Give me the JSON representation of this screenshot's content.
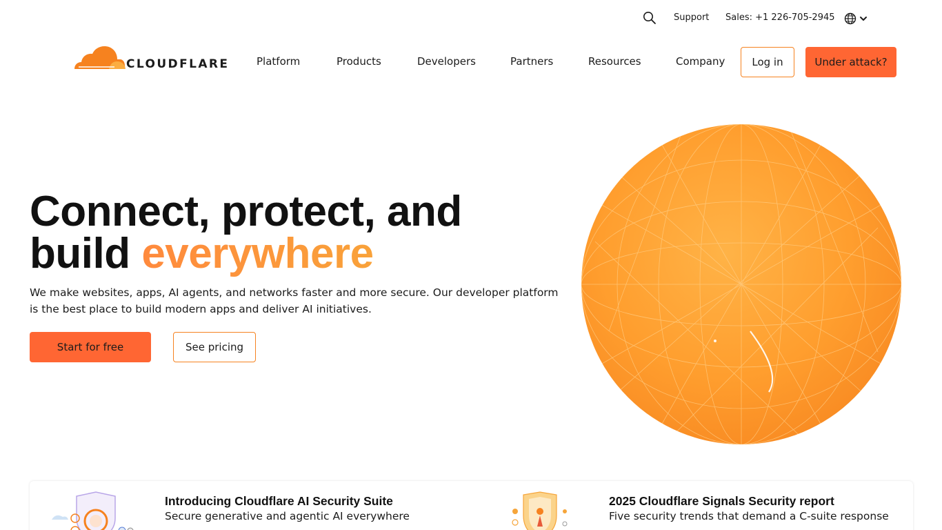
{
  "utility_bar": {
    "search_icon": "search-icon",
    "support_label": "Support",
    "sales_label": "Sales: +1 226-705-2945",
    "language_icon": "globe-icon"
  },
  "brand": {
    "logo_text": "CLOUDFLARE",
    "logo_colors": {
      "primary": "#f6821f",
      "secondary": "#fbad41"
    }
  },
  "nav": {
    "items": [
      {
        "label": "Platform"
      },
      {
        "label": "Products"
      },
      {
        "label": "Developers"
      },
      {
        "label": "Partners"
      },
      {
        "label": "Resources"
      },
      {
        "label": "Company"
      }
    ],
    "login_label": "Log in",
    "attack_label": "Under attack?"
  },
  "hero": {
    "title_part1": "Connect, protect, and",
    "title_part2": "build",
    "title_accent": "everywhere",
    "subtitle": "We make websites, apps, AI agents, and networks faster and more secure. Our developer platform is the best place to build modern apps and deliver AI initiatives.",
    "cta_primary": "Start for free",
    "cta_secondary": "See pricing"
  },
  "promos": [
    {
      "title": "Introducing Cloudflare AI Security Suite",
      "description": "Secure generative and agentic AI everywhere"
    },
    {
      "title": "2025 Cloudflare Signals Security report",
      "description": "Five security trends that demand a C-suite response"
    }
  ],
  "colors": {
    "accent": "#ff6633",
    "brand_orange": "#f6821f",
    "text": "#1b1b1b"
  }
}
